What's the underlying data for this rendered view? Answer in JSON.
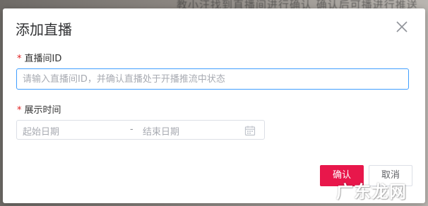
{
  "background": {
    "partial_text": "教小汪找到直播间进行确认 确认后可播进行推送"
  },
  "dialog": {
    "title": "添加直播",
    "close_icon": "close-icon",
    "fields": {
      "room_id": {
        "label": "直播间ID",
        "required_mark": "*",
        "placeholder": "请输入直播间ID，并确认直播处于开播推流中状态",
        "value": ""
      },
      "display_time": {
        "label": "展示时间",
        "required_mark": "*",
        "start_placeholder": "起始日期",
        "separator": "-",
        "end_placeholder": "结束日期",
        "icon": "calendar-icon"
      }
    },
    "buttons": {
      "confirm": "确认",
      "cancel": "取消"
    }
  },
  "watermark": {
    "text": "广东龙网"
  },
  "colors": {
    "accent_focus": "#409eff",
    "confirm_button": "#e8174b",
    "required_mark": "#e02020"
  }
}
